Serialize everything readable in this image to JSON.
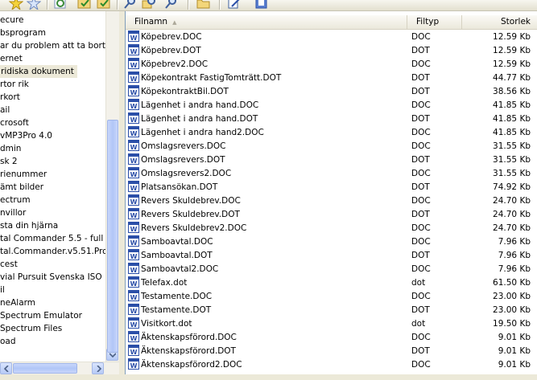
{
  "toolbar": {
    "buttons": [
      "star-icon",
      "star-icon",
      "refresh-icon",
      "folder-check-icon",
      "folder-check-icon",
      "search-icon",
      "search-folder-icon",
      "search-icon",
      "folder-icon",
      "edit-icon",
      "properties-icon"
    ]
  },
  "tree": {
    "items": [
      {
        "label": "ecure"
      },
      {
        "label": "bsprogram"
      },
      {
        "label": "ar du problem att ta bort filn"
      },
      {
        "label": "ernet"
      },
      {
        "label": "ridiska dokument",
        "selected": true
      },
      {
        "label": "rtor rik"
      },
      {
        "label": "rkort"
      },
      {
        "label": "ail"
      },
      {
        "label": "crosoft"
      },
      {
        "label": "vMP3Pro 4.0"
      },
      {
        "label": "dmin"
      },
      {
        "label": "sk 2"
      },
      {
        "label": "rienummer"
      },
      {
        "label": "ämt bilder"
      },
      {
        "label": "ectrum"
      },
      {
        "label": "nvillor"
      },
      {
        "label": "sta din hjärna"
      },
      {
        "label": "tal Commander 5.5 - full"
      },
      {
        "label": "tal.Commander.v5.51.Pro"
      },
      {
        "label": "cest"
      },
      {
        "label": "vial Pursuit Svenska ISO"
      },
      {
        "label": "il"
      },
      {
        "label": "neAlarm"
      },
      {
        "label": " Spectrum Emulator"
      },
      {
        "label": " Spectrum Files"
      },
      {
        "label": "oad"
      }
    ]
  },
  "filelist": {
    "columns": {
      "name": "Filnamn",
      "type": "Filtyp",
      "size": "Storlek"
    },
    "rows": [
      {
        "name": "Köpebrev.DOC",
        "type": "DOC",
        "size": "12.59 Kb"
      },
      {
        "name": "Köpebrev.DOT",
        "type": "DOT",
        "size": "12.59 Kb"
      },
      {
        "name": "Köpebrev2.DOC",
        "type": "DOC",
        "size": "12.59 Kb"
      },
      {
        "name": "Köpekontrakt FastigTomträtt.DOT",
        "type": "DOT",
        "size": "44.77 Kb"
      },
      {
        "name": "KöpekontraktBil.DOT",
        "type": "DOT",
        "size": "38.56 Kb"
      },
      {
        "name": "Lägenhet i andra hand.DOC",
        "type": "DOC",
        "size": "41.85 Kb"
      },
      {
        "name": "Lägenhet i andra hand.DOT",
        "type": "DOT",
        "size": "41.85 Kb"
      },
      {
        "name": "Lägenhet i andra hand2.DOC",
        "type": "DOC",
        "size": "41.85 Kb"
      },
      {
        "name": "Omslagsrevers.DOC",
        "type": "DOC",
        "size": "31.55 Kb"
      },
      {
        "name": "Omslagsrevers.DOT",
        "type": "DOT",
        "size": "31.55 Kb"
      },
      {
        "name": "Omslagsrevers2.DOC",
        "type": "DOC",
        "size": "31.55 Kb"
      },
      {
        "name": "Platsansökan.DOT",
        "type": "DOT",
        "size": "74.92 Kb"
      },
      {
        "name": "Revers Skuldebrev.DOC",
        "type": "DOC",
        "size": "24.70 Kb"
      },
      {
        "name": "Revers Skuldebrev.DOT",
        "type": "DOT",
        "size": "24.70 Kb"
      },
      {
        "name": "Revers Skuldebrev2.DOC",
        "type": "DOC",
        "size": "24.70 Kb"
      },
      {
        "name": "Samboavtal.DOC",
        "type": "DOC",
        "size": "7.96 Kb"
      },
      {
        "name": "Samboavtal.DOT",
        "type": "DOT",
        "size": "7.96 Kb"
      },
      {
        "name": "Samboavtal2.DOC",
        "type": "DOC",
        "size": "7.96 Kb"
      },
      {
        "name": "Telefax.dot",
        "type": "dot",
        "size": "61.50 Kb"
      },
      {
        "name": "Testamente.DOC",
        "type": "DOC",
        "size": "23.00 Kb"
      },
      {
        "name": "Testamente.DOT",
        "type": "DOT",
        "size": "23.00 Kb"
      },
      {
        "name": "Visitkort.dot",
        "type": "dot",
        "size": "19.50 Kb"
      },
      {
        "name": "Äktenskapsförord.DOC",
        "type": "DOC",
        "size": "9.01 Kb"
      },
      {
        "name": "Äktenskapsförord.DOT",
        "type": "DOT",
        "size": "9.01 Kb"
      },
      {
        "name": "Äktenskapsförord2.DOC",
        "type": "DOC",
        "size": "9.01 Kb"
      }
    ],
    "icon": "word-document-icon"
  },
  "colors": {
    "word_blue": "#2b4fa8",
    "selection_bg": "#ece9d8",
    "scroll_blue": "#b1c6f7"
  }
}
